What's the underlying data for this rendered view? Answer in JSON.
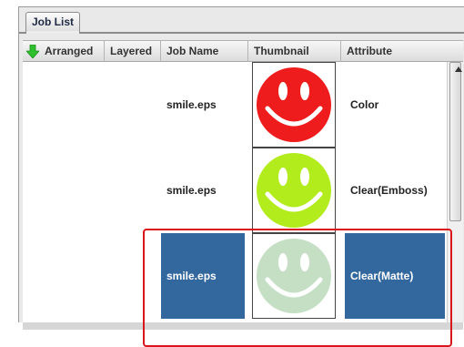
{
  "tab": {
    "label": "Job List"
  },
  "columns": [
    "Arranged",
    "Layered",
    "Job Name",
    "Thumbnail",
    "Attribute"
  ],
  "rows": [
    {
      "job_name": "smile.eps",
      "attribute": "Color",
      "thumb_color": "#ee1c1c",
      "selected": false
    },
    {
      "job_name": "smile.eps",
      "attribute": "Clear(Emboss)",
      "thumb_color": "#b3ec1c",
      "selected": false
    },
    {
      "job_name": "smile.eps",
      "attribute": "Clear(Matte)",
      "thumb_color": "#c4dfc4",
      "selected": true
    }
  ],
  "colors": {
    "selection": "#33689f",
    "highlight_frame": "#d9161c",
    "sort_arrow": "#2fc02f"
  },
  "icons": {
    "sort": "green-down-arrow-icon",
    "thumbnail": "smiley-face-icon"
  }
}
